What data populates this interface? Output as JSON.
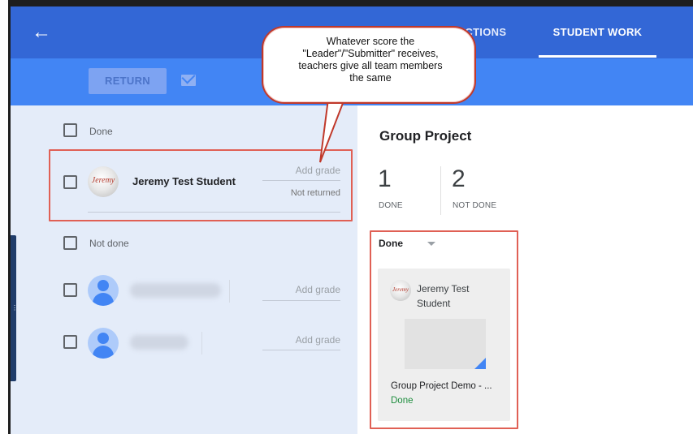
{
  "appbar": {
    "tabs": [
      {
        "label": "INSTRUCTIONS",
        "visible_label": "RUCTIONS"
      },
      {
        "label": "STUDENT WORK"
      }
    ]
  },
  "toolbar": {
    "return_label": "RETURN"
  },
  "callout": {
    "text": "Whatever score the \"Leader\"/\"Submitter\" receives, teachers give all team members the same",
    "lines": [
      "Whatever score the",
      "\"Leader\"/\"Submitter\" receives,",
      "teachers give all team members",
      "the same"
    ]
  },
  "left_panel": {
    "done_section": {
      "label": "Done",
      "students": [
        {
          "name": "Jeremy Test Student",
          "avatar_text": "Jeremy",
          "grade_placeholder": "Add grade",
          "status": "Not returned"
        }
      ]
    },
    "not_done_section": {
      "label": "Not done",
      "students": [
        {
          "grade_placeholder": "Add grade"
        },
        {
          "grade_placeholder": "Add grade"
        }
      ]
    }
  },
  "right_panel": {
    "title": "Group Project",
    "stats": [
      {
        "value": "1",
        "label": "DONE"
      },
      {
        "value": "2",
        "label": "NOT DONE"
      }
    ],
    "filter": {
      "selected": "Done"
    },
    "cards": [
      {
        "student_name": "Jeremy Test Student",
        "avatar_text": "Jeremy",
        "attachment_title": "Group Project Demo - ...",
        "status": "Done"
      }
    ]
  },
  "colors": {
    "appbar": "#3367d6",
    "toolbar": "#4285f4",
    "left_panel_bg": "#e4ecf9",
    "highlight": "#e06055",
    "done_status": "#1e8e3e"
  },
  "icons": [
    "back-arrow-icon",
    "mail-icon",
    "dropdown-caret-icon",
    "person-icon"
  ]
}
